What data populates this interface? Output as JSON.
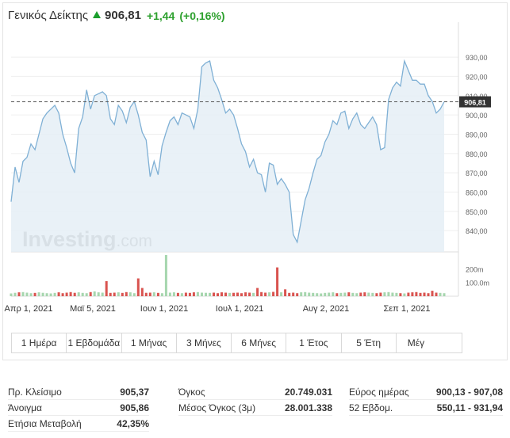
{
  "header": {
    "name": "Γενικός Δείκτης",
    "price": "906,81",
    "change": "+1,44",
    "change_pct": "(+0,16%)",
    "up_color": "#2ea12f"
  },
  "chart_data": {
    "type": "line",
    "title": "",
    "current_price_label": "906,81",
    "current_price": 906.81,
    "y_ticks": [
      "930,00",
      "920,00",
      "910,00",
      "900,00",
      "890,00",
      "880,00",
      "870,00",
      "860,00",
      "850,00",
      "840,00"
    ],
    "y_tick_values": [
      930,
      920,
      910,
      900,
      890,
      880,
      870,
      860,
      850,
      840
    ],
    "ylim": [
      829,
      944
    ],
    "x_ticks": [
      "Απρ 1, 2021",
      "Μαϊ 5, 2021",
      "Ιουν 1, 2021",
      "Ιουλ 1, 2021",
      "Αυγ 2, 2021",
      "Σεπ 1, 2021"
    ],
    "price_values": [
      855,
      873,
      865,
      876,
      878,
      885,
      882,
      890,
      898,
      901,
      903,
      905,
      901,
      890,
      883,
      875,
      870,
      893,
      899,
      913,
      903,
      910,
      911,
      912,
      910,
      898,
      895,
      905,
      902,
      896,
      904,
      907,
      900,
      891,
      887,
      868,
      876,
      869,
      884,
      891,
      897,
      899,
      895,
      901,
      900,
      899,
      893,
      903,
      925,
      927,
      928,
      918,
      914,
      908,
      901,
      903,
      900,
      893,
      885,
      881,
      873,
      877,
      870,
      869,
      860,
      875,
      874,
      864,
      867,
      864,
      860,
      838,
      834,
      845,
      856,
      862,
      870,
      877,
      879,
      886,
      890,
      897,
      895,
      901,
      902,
      893,
      898,
      901,
      895,
      893,
      896,
      899,
      895,
      882,
      883,
      908,
      914,
      917,
      915,
      928,
      923,
      918,
      918,
      916,
      916,
      910,
      907,
      901,
      903,
      906.81
    ],
    "volume_scale_labels": [
      "200m",
      "100.0m"
    ],
    "volume_values": [
      20,
      25,
      28,
      30,
      26,
      22,
      24,
      28,
      25,
      22,
      20,
      24,
      28,
      22,
      26,
      30,
      25,
      28,
      24,
      22,
      30,
      35,
      28,
      26,
      110,
      24,
      26,
      28,
      24,
      30,
      28,
      22,
      130,
      60,
      25,
      26,
      28,
      24,
      22,
      300,
      26,
      28,
      24,
      22,
      26,
      24,
      28,
      30,
      26,
      25,
      24,
      26,
      22,
      28,
      26,
      24,
      25,
      26,
      22,
      28,
      26,
      24,
      60,
      30,
      26,
      28,
      32,
      210,
      28,
      50,
      24,
      26,
      22,
      28,
      30,
      26,
      24,
      22,
      20,
      24,
      26,
      28,
      22,
      24,
      26,
      28,
      24,
      22,
      26,
      28,
      26,
      24,
      22,
      26,
      28,
      30,
      26,
      24,
      22,
      20,
      26,
      28,
      30,
      24,
      26,
      22,
      40,
      26,
      24,
      22
    ],
    "volume_up": [
      true,
      true,
      false,
      true,
      true,
      true,
      false,
      true,
      true,
      true,
      true,
      true,
      false,
      false,
      false,
      false,
      false,
      true,
      true,
      true,
      false,
      true,
      true,
      true,
      false,
      false,
      false,
      true,
      false,
      false,
      true,
      true,
      false,
      false,
      false,
      false,
      true,
      false,
      true,
      true,
      true,
      true,
      false,
      true,
      false,
      false,
      false,
      true,
      true,
      true,
      true,
      false,
      false,
      false,
      false,
      true,
      false,
      false,
      false,
      false,
      false,
      true,
      false,
      false,
      false,
      true,
      false,
      false,
      true,
      false,
      false,
      false,
      false,
      true,
      true,
      true,
      true,
      true,
      true,
      true,
      true,
      true,
      false,
      true,
      true,
      false,
      true,
      true,
      false,
      false,
      true,
      true,
      false,
      false,
      true,
      true,
      true,
      true,
      false,
      true,
      false,
      false,
      false,
      false,
      false,
      false,
      false,
      false,
      true,
      true
    ],
    "line_color": "#7fb0d5",
    "area_color": "#e5eef6",
    "up_color": "#a6d6ae",
    "down_color": "#d9534f",
    "dashed_line_color": "#555555",
    "watermark": "Investing.com"
  },
  "ranges": [
    "1 Ημέρα",
    "1 Εβδομάδα",
    "1 Μήνας",
    "3 Μήνες",
    "6 Μήνες",
    "1 Έτος",
    "5 Έτη",
    "Μέγ"
  ],
  "stats": {
    "col1": [
      {
        "label": "Πρ. Κλείσιμο",
        "value": "905,37"
      },
      {
        "label": "Άνοιγμα",
        "value": "905,86"
      },
      {
        "label": "Ετήσια Μεταβολή",
        "value": "42,35%"
      }
    ],
    "col2": [
      {
        "label": "Όγκος",
        "value": "20.749.031"
      },
      {
        "label": "Μέσος Όγκος (3μ)",
        "value": "28.001.338"
      }
    ],
    "col3": [
      {
        "label": "Εύρος ημέρας",
        "value": "900,13 - 907,08"
      },
      {
        "label": "52 Εβδομ.",
        "value": "550,11 - 931,94"
      }
    ]
  }
}
